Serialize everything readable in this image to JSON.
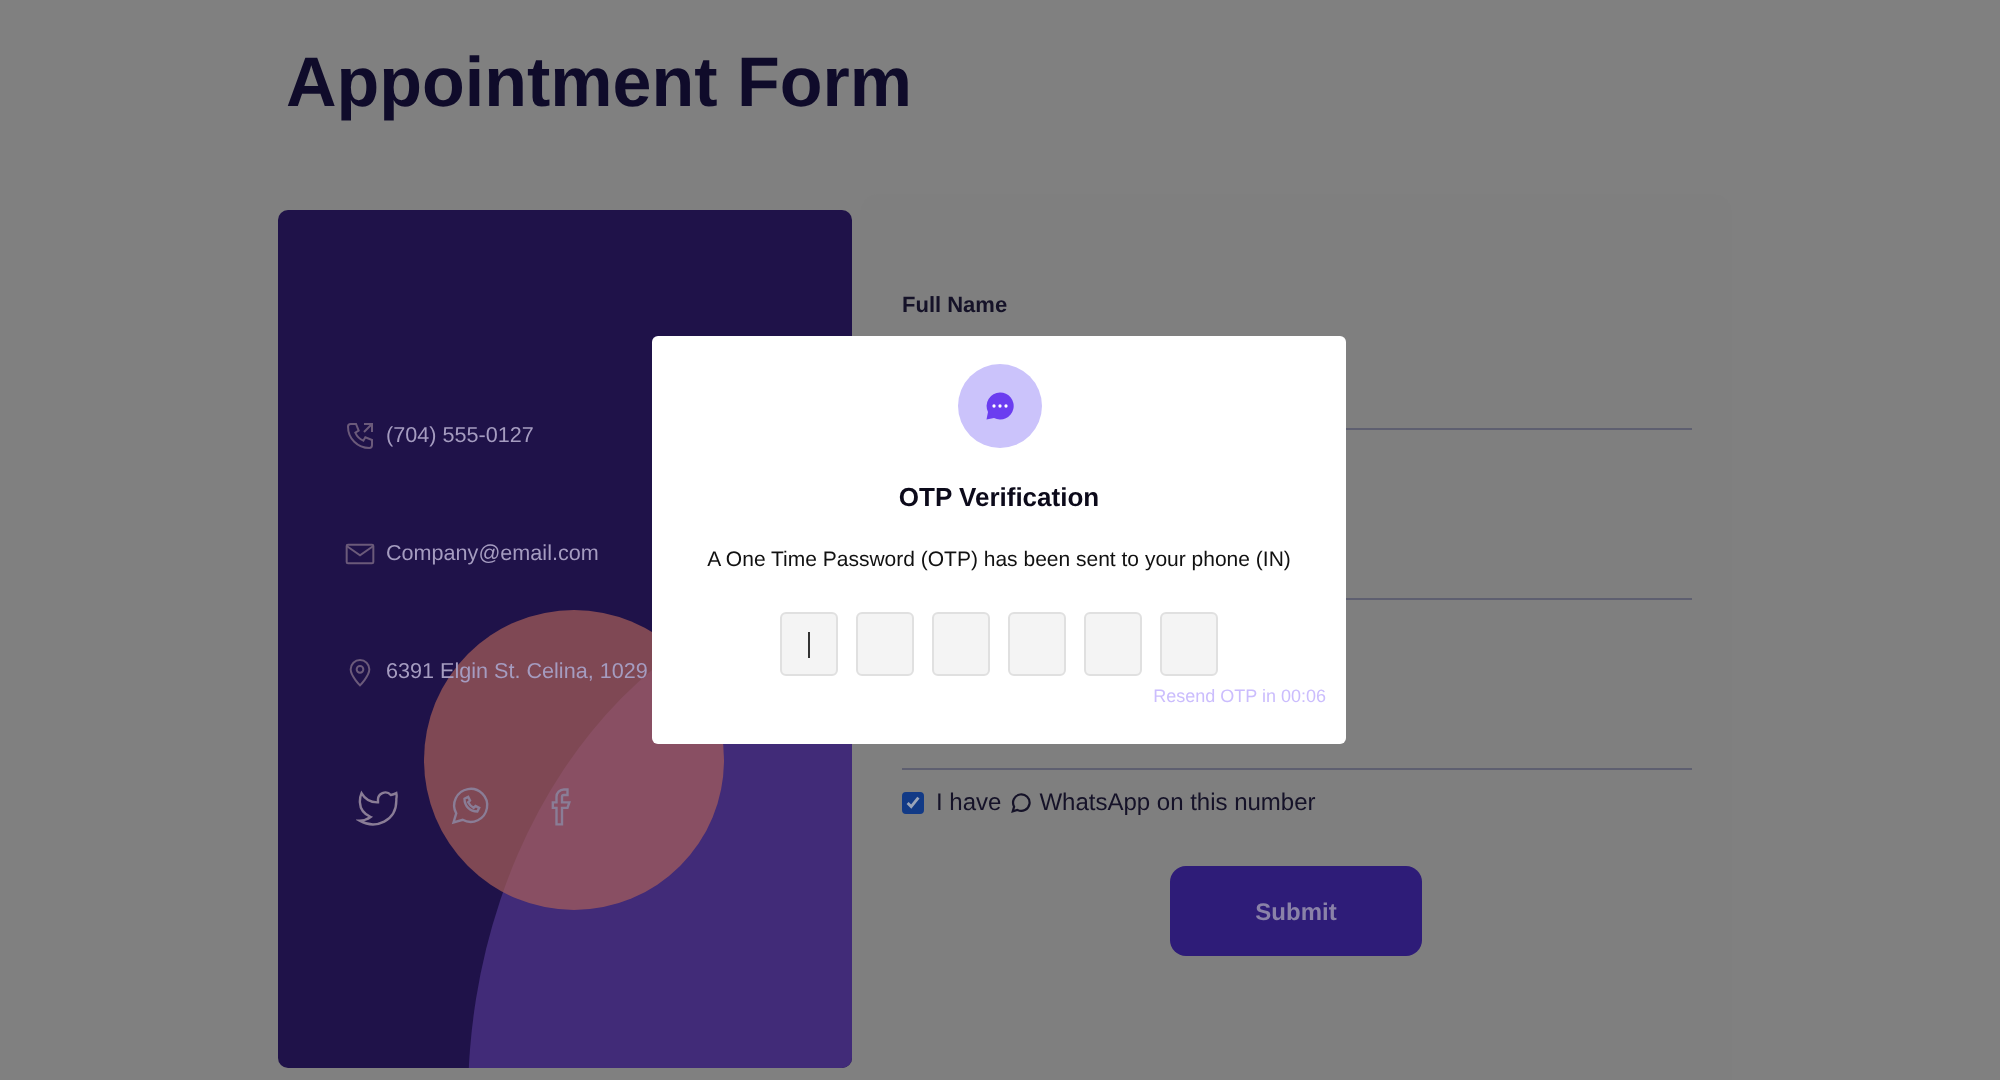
{
  "page_title": "Appointment Form",
  "contacts": [
    {
      "kind": "phone",
      "text": "(704) 555-0127"
    },
    {
      "kind": "email",
      "text": "Company@email.com"
    },
    {
      "kind": "location",
      "text": "6391 Elgin St. Celina, 1029"
    }
  ],
  "socials": [
    {
      "kind": "twitter"
    },
    {
      "kind": "whatsapp"
    },
    {
      "kind": "facebook"
    }
  ],
  "fields": [
    {
      "kind": "text",
      "label": "Full Name"
    },
    {
      "kind": "text"
    },
    {
      "kind": "text"
    }
  ],
  "whatsapp_check": {
    "checked": true,
    "before": "I have",
    "after": "WhatsApp on this number"
  },
  "submit": "Submit",
  "modal": {
    "title": "OTP Verification",
    "message": "A One Time Password (OTP) has been sent to your phone (IN)",
    "digits": [
      {
        "focused": true
      },
      {
        "focused": false
      },
      {
        "focused": false
      },
      {
        "focused": false
      },
      {
        "focused": false
      },
      {
        "focused": false
      }
    ],
    "resend": "Resend OTP in 00:06"
  }
}
